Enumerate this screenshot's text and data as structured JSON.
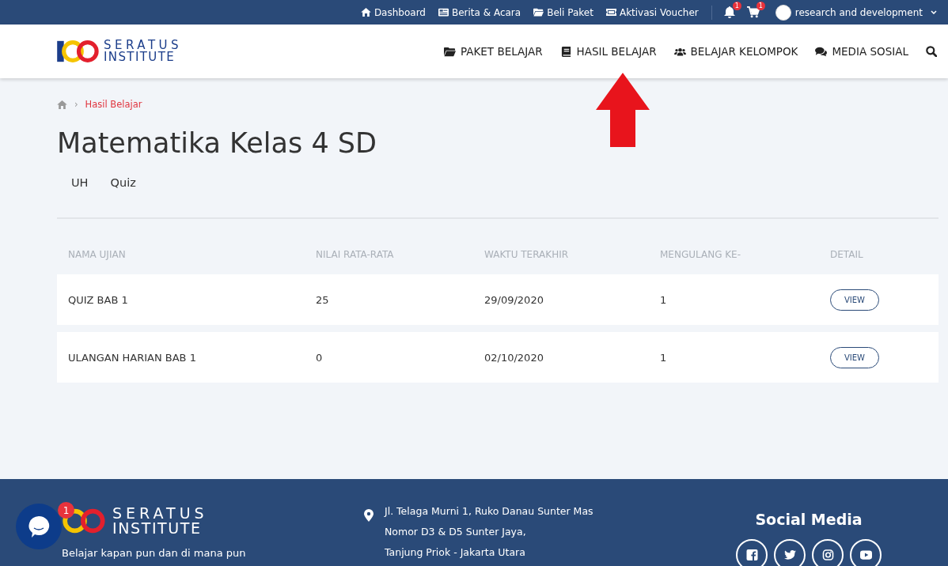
{
  "topbar": {
    "links": [
      {
        "kind": "home",
        "label": "Dashboard"
      },
      {
        "kind": "news",
        "label": "Berita & Acara"
      },
      {
        "kind": "folder",
        "label": "Beli Paket"
      },
      {
        "kind": "ticket",
        "label": "Aktivasi Voucher"
      }
    ],
    "notifications": {
      "count": "1"
    },
    "cart": {
      "count": "1"
    },
    "user": {
      "name": "research and development"
    }
  },
  "header": {
    "logo": {
      "line1": "SERATUS",
      "line2": "INSTITUTE"
    },
    "nav": [
      {
        "kind": "folder",
        "label": "PAKET BELAJAR"
      },
      {
        "kind": "book",
        "label": "HASIL BELAJAR"
      },
      {
        "kind": "users",
        "label": "BELAJAR KELOMPOK"
      },
      {
        "kind": "chat",
        "label": "MEDIA SOSIAL"
      }
    ]
  },
  "breadcrumb": {
    "separator": "›",
    "current": "Hasil Belajar"
  },
  "page_title": "Matematika Kelas 4 SD",
  "tabs": [
    {
      "label": "UH"
    },
    {
      "label": "Quiz"
    }
  ],
  "table": {
    "columns": [
      "NAMA UJIAN",
      "NILAI RATA-RATA",
      "WAKTU TERAKHIR",
      "MENGULANG KE-",
      "DETAIL"
    ],
    "rows": [
      {
        "name": "QUIZ BAB 1",
        "score": "25",
        "time": "29/09/2020",
        "attempt": "1",
        "action": "VIEW"
      },
      {
        "name": "ULANGAN HARIAN BAB 1",
        "score": "0",
        "time": "02/10/2020",
        "attempt": "1",
        "action": "VIEW"
      }
    ]
  },
  "footer": {
    "logo": {
      "line1": "SERATUS",
      "line2": "INSTITUTE"
    },
    "tagline": "Belajar kapan pun dan di mana pun",
    "address": [
      "Jl. Telaga Murni 1, Ruko Danau Sunter Mas",
      "Nomor D3 & D5 Sunter Jaya,",
      "Tanjung Priok - Jakarta Utara"
    ],
    "social_title": "Social Media",
    "social": [
      {
        "kind": "facebook"
      },
      {
        "kind": "twitter"
      },
      {
        "kind": "instagram"
      },
      {
        "kind": "youtube"
      }
    ]
  },
  "chat_widget": {
    "count": "1"
  }
}
